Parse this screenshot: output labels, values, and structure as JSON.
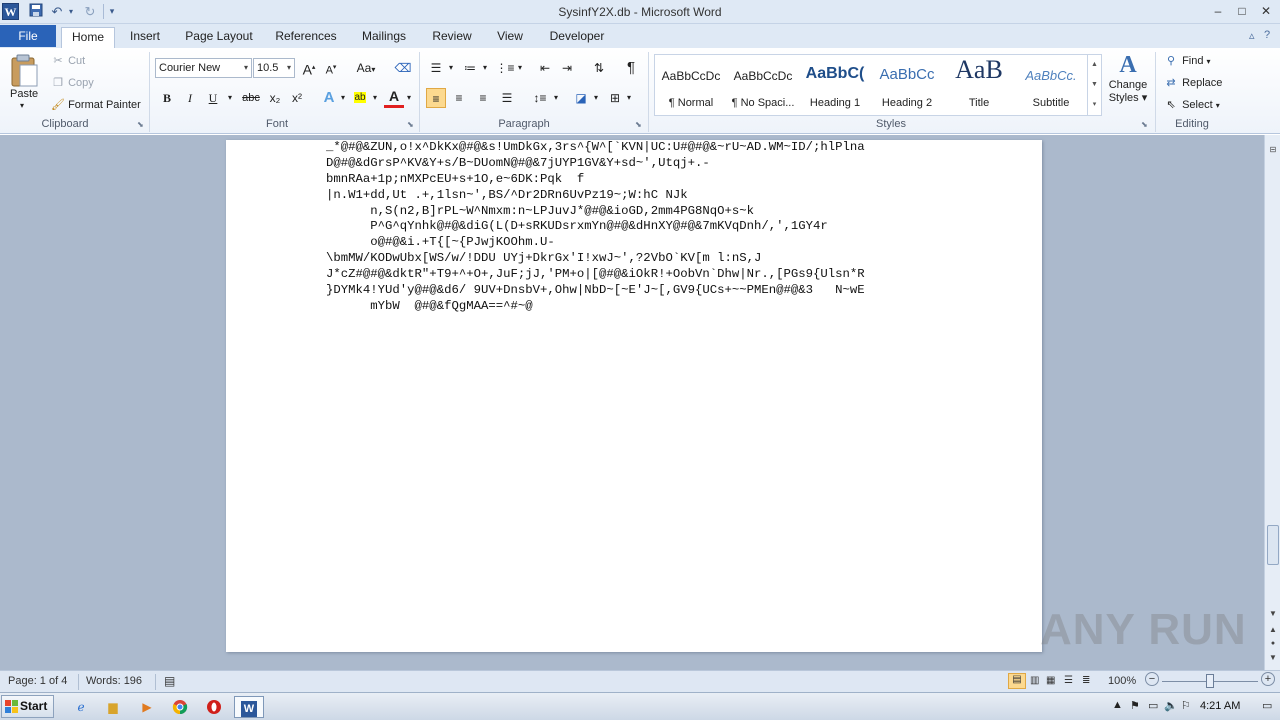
{
  "window": {
    "title": "SysinfY2X.db - Microsoft Word",
    "minimize": "–",
    "maximize": "□",
    "close": "✕"
  },
  "quick_access": {
    "app_logo": "W",
    "save_icon": "💾",
    "undo_icon": "↶",
    "redo_icon": "↻",
    "customize_icon": "▾"
  },
  "tabs": {
    "file": "File",
    "items": [
      "Home",
      "Insert",
      "Page Layout",
      "References",
      "Mailings",
      "Review",
      "View",
      "Developer"
    ],
    "active": "Home"
  },
  "ribbon": {
    "clipboard": {
      "label": "Clipboard",
      "paste": "Paste",
      "cut": "Cut",
      "copy": "Copy",
      "format_painter": "Format Painter"
    },
    "font": {
      "label": "Font",
      "font_name": "Courier New",
      "font_size": "10.5",
      "grow": "A",
      "shrink": "A",
      "change_case": "Aa",
      "bold": "B",
      "italic": "I",
      "underline": "U",
      "strike": "abc",
      "subscript": "x₂",
      "superscript": "x²",
      "text_effects": "A",
      "highlight": "ab",
      "font_color": "A"
    },
    "paragraph": {
      "label": "Paragraph",
      "pilcrow": "¶"
    },
    "styles": {
      "label": "Styles",
      "items": [
        {
          "sample": "AaBbCcDc",
          "name": "¶ Normal"
        },
        {
          "sample": "AaBbCcDc",
          "name": "¶ No Spaci..."
        },
        {
          "sample": "AaBbC(",
          "name": "Heading 1"
        },
        {
          "sample": "AaBbCc",
          "name": "Heading 2"
        },
        {
          "sample": "AaB",
          "name": "Title"
        },
        {
          "sample": "AaBbCc.",
          "name": "Subtitle"
        }
      ],
      "change_styles": "Change Styles",
      "change_styles_line1": "Change",
      "change_styles_line2": "Styles ▾"
    },
    "editing": {
      "label": "Editing",
      "find": "Find",
      "replace": "Replace",
      "select": "Select"
    }
  },
  "document": {
    "lines": [
      "_*@#@&ZUN,o!x^DkKx@#@&s!UmDkGx,3rs^{W^[`KVN|UC:U#@#@&~rU~AD.WM~ID/;hlPlna",
      "D@#@&dGrsP^KV&Y+s/B~DUomN@#@&7jUYP1GV&Y+sd~',Utqj+.-",
      "bmnRAa+1p;nMXPcEU+s+1O,e~6DK:Pqk  f",
      "|n.W1+dd,Ut .+,1lsn~',BS/^Dr2DRn6UvPz19~;W:hC NJk",
      "      n,S(n2,B]rPL~W^Nmxm:n~LPJuvJ*@#@&ioGD,2mm4PG8NqO+s~k",
      "      P^G^qYnhk@#@&diG(L(D+sRKUDsrxmYn@#@&dHnXY@#@&7mKVqDnh/,',1GY4r",
      "      o@#@&i.+T{[~{PJwjKOOhm.U-",
      "\\bmMW/KODwUbx[WS/w/!DDU UYj+DkrGx'I!xwJ~',?2VbO`KV[m l:nS,J",
      "J*cZ#@#@&dktR\"+T9+^+O+,JuF;jJ,'PM+o|[@#@&iOkR!+OobVn`Dhw|Nr.,[PGs9{Ulsn*R",
      "}DYMk4!YUd'y@#@&d6/ 9UV+DnsbV+,Ohw|NbD~[~E'J~[,GV9{UCs+~~PMEn@#@&3   N~wE",
      "      mYbW  @#@&fQgMAA==^#~@"
    ]
  },
  "statusbar": {
    "page": "Page: 1 of 4",
    "words": "Words: 196",
    "zoom": "100%",
    "zoom_minus": "−",
    "zoom_plus": "+"
  },
  "watermark": "ANY RUN",
  "taskbar": {
    "start": "Start",
    "clock": "4:21 AM"
  },
  "colors": {
    "file_tab": "#2a63b8",
    "ribbon_bg": "#eef3fa",
    "workspace": "#abb9cc",
    "active_button": "#fcd98f"
  }
}
